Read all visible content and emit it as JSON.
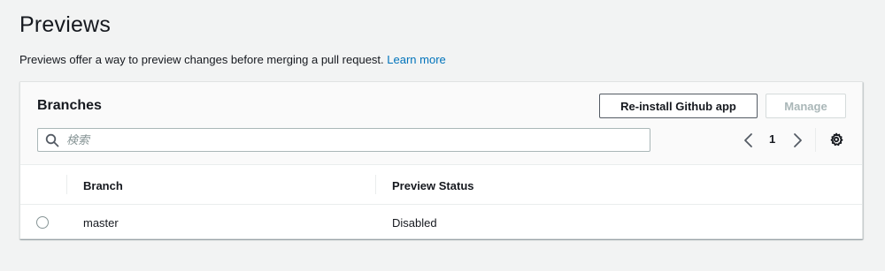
{
  "page": {
    "title": "Previews",
    "description": "Previews offer a way to preview changes before merging a pull request.",
    "learn_more": "Learn more"
  },
  "panel": {
    "title": "Branches",
    "reinstall_label": "Re-install Github app",
    "manage_label": "Manage",
    "search_placeholder": "検索",
    "page_number": "1",
    "columns": [
      "Branch",
      "Preview Status"
    ],
    "rows": [
      {
        "branch": "master",
        "status": "Disabled"
      }
    ]
  },
  "colors": {
    "link": "#0073bb",
    "background": "#f2f3f3"
  }
}
